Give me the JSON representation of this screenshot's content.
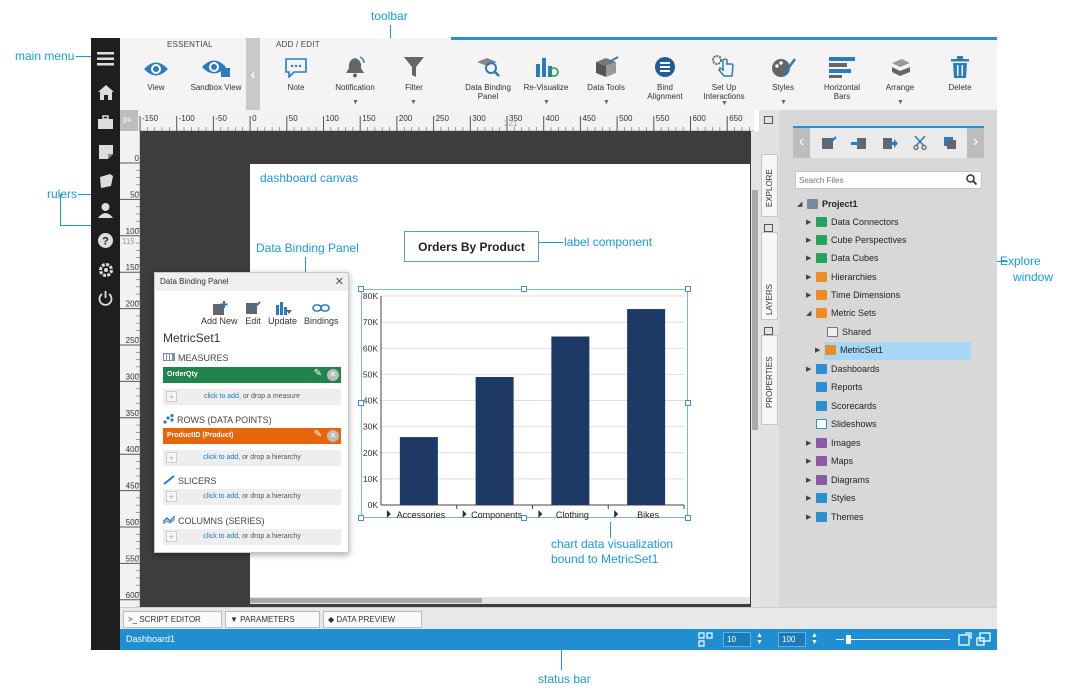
{
  "callouts": {
    "toolbar": "toolbar",
    "main_menu": "main menu",
    "rulers": "rulers",
    "dashboard_canvas": "dashboard canvas",
    "data_binding_panel": "Data Binding Panel",
    "label_component": "label component",
    "explore_window_1": "Explore",
    "explore_window_2": "window",
    "chart_line1": "chart data visualization",
    "chart_line2": "bound to MetricSet1",
    "status_bar": "status bar"
  },
  "toolbar": {
    "group_essential": "ESSENTIAL",
    "group_add_edit": "ADD / EDIT",
    "buttons": {
      "view": "View",
      "sandbox_view": "Sandbox View",
      "note": "Note",
      "notification": "Notification",
      "filter": "Filter",
      "data_binding_panel_1": "Data Binding",
      "data_binding_panel_2": "Panel",
      "revisualize": "Re-Visualize",
      "data_tools": "Data Tools",
      "bind_alignment_1": "Bind",
      "bind_alignment_2": "Alignment",
      "setup_interactions_1": "Set Up",
      "setup_interactions_2": "Interactions",
      "styles": "Styles",
      "horizontal_bars_1": "Horizontal",
      "horizontal_bars_2": "Bars",
      "arrange": "Arrange",
      "delete": "Delete"
    }
  },
  "ruler": {
    "unit": "px",
    "h_ticks": [
      "-150",
      "-100",
      "-50",
      "0",
      "50",
      "100",
      "150",
      "200",
      "250",
      "300",
      "350",
      "400",
      "450",
      "500",
      "550",
      "600",
      "650"
    ],
    "h_marker": "321",
    "v_ticks": [
      "0",
      "50",
      "100",
      "150",
      "200",
      "250",
      "300",
      "350",
      "400",
      "450",
      "500",
      "550",
      "600"
    ],
    "v_marker": "115"
  },
  "label_component": {
    "text": "Orders By Product"
  },
  "chart_data": {
    "type": "bar",
    "categories": [
      "Accessories",
      "Components",
      "Clothing",
      "Bikes"
    ],
    "values": [
      26000,
      49000,
      64500,
      75000
    ],
    "ylim": [
      0,
      80000
    ],
    "yticks": [
      "0K",
      "10K",
      "20K",
      "30K",
      "40K",
      "50K",
      "60K",
      "70K",
      "80K"
    ],
    "bar_color": "#1d3a66",
    "title": "",
    "xlabel": "",
    "ylabel": ""
  },
  "data_binding_panel": {
    "title": "Data Binding Panel",
    "close": "✕",
    "actions": {
      "add_new": "Add New",
      "edit": "Edit",
      "update": "Update",
      "bindings": "Bindings"
    },
    "metricset": "MetricSet1",
    "measures_label": "MEASURES",
    "measure_item": "OrderQty",
    "rows_label": "ROWS (DATA POINTS)",
    "row_item": "ProductID (Product)",
    "slicers_label": "SLICERS",
    "columns_label": "COLUMNS (SERIES)",
    "drop_measure_link": "click to add,",
    "drop_measure_rest": " or drop a measure",
    "drop_hier_link": "click to add,",
    "drop_hier_rest": " or drop a hierarchy",
    "measure_color": "#21844c",
    "row_color": "#e8650e"
  },
  "bottom_tabs": {
    "script_editor": "SCRIPT EDITOR",
    "parameters": "PARAMETERS",
    "data_preview": "DATA PREVIEW"
  },
  "status_bar": {
    "dashboard_name": "Dashboard1",
    "grid_size": "10",
    "zoom": "100"
  },
  "side_tabs": {
    "explore": "EXPLORE",
    "layers": "LAYERS",
    "properties": "PROPERTIES"
  },
  "explore": {
    "search_placeholder": "Search Files",
    "tree": {
      "project": "Project1",
      "data_connectors": "Data Connectors",
      "cube_perspectives": "Cube Perspectives",
      "data_cubes": "Data Cubes",
      "hierarchies": "Hierarchies",
      "time_dimensions": "Time Dimensions",
      "metric_sets": "Metric Sets",
      "shared": "Shared",
      "metricset1": "MetricSet1",
      "dashboards": "Dashboards",
      "reports": "Reports",
      "scorecards": "Scorecards",
      "slideshows": "Slideshows",
      "images": "Images",
      "maps": "Maps",
      "diagrams": "Diagrams",
      "styles": "Styles",
      "themes": "Themes"
    }
  }
}
